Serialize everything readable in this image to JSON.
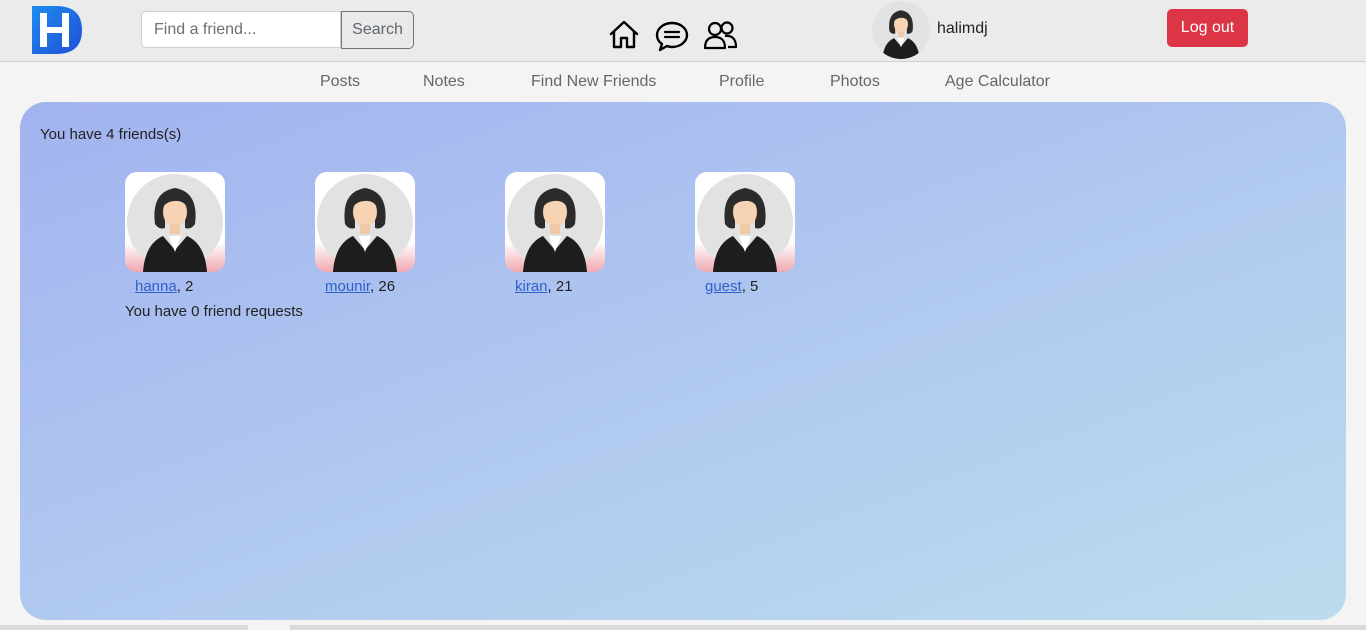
{
  "header": {
    "logo_text": "H",
    "search": {
      "placeholder": "Find a friend...",
      "value": "",
      "button_label": "Search"
    },
    "icons": [
      "home-icon",
      "messages-icon",
      "friends-icon"
    ],
    "user": {
      "name": "halimdj"
    },
    "logout_label": "Log out"
  },
  "subnav": {
    "tabs": [
      {
        "label": "Posts"
      },
      {
        "label": "Notes"
      },
      {
        "label": "Find New Friends"
      },
      {
        "label": "Profile"
      },
      {
        "label": "Photos"
      },
      {
        "label": "Age Calculator"
      }
    ]
  },
  "main": {
    "friends_count_text": "You have 4 friends(s)",
    "friends": [
      {
        "name": "hanna",
        "suffix": ", 2"
      },
      {
        "name": "mounir",
        "suffix": ", 26"
      },
      {
        "name": "kiran",
        "suffix": ", 21"
      },
      {
        "name": "guest",
        "suffix": ", 5"
      }
    ],
    "requests_text": "You have 0 friend requests"
  },
  "colors": {
    "logout": "#dc3545",
    "logo_blue": "#1f6fe0",
    "panel_gradient_start": "#a2b3f0",
    "panel_gradient_end": "#bcdcee",
    "link": "#2f62c9"
  }
}
